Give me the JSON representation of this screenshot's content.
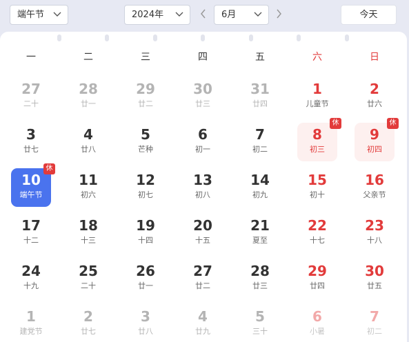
{
  "toolbar": {
    "festival_select": "端午节",
    "year_select": "2024年",
    "month_select": "6月",
    "today_label": "今天"
  },
  "weekdays": [
    "一",
    "二",
    "三",
    "四",
    "五",
    "六",
    "日"
  ],
  "colors": {
    "accent": "#4a73ee",
    "holiday_red": "#e23b3b",
    "holiday_bg": "#fdf0ef"
  },
  "weeks": [
    [
      {
        "day": "27",
        "lunar": "二十",
        "other": true
      },
      {
        "day": "28",
        "lunar": "廿一",
        "other": true
      },
      {
        "day": "29",
        "lunar": "廿二",
        "other": true
      },
      {
        "day": "30",
        "lunar": "廿三",
        "other": true
      },
      {
        "day": "31",
        "lunar": "廿四",
        "other": true
      },
      {
        "day": "1",
        "lunar": "儿童节"
      },
      {
        "day": "2",
        "lunar": "廿六"
      }
    ],
    [
      {
        "day": "3",
        "lunar": "廿七"
      },
      {
        "day": "4",
        "lunar": "廿八"
      },
      {
        "day": "5",
        "lunar": "芒种"
      },
      {
        "day": "6",
        "lunar": "初一"
      },
      {
        "day": "7",
        "lunar": "初二"
      },
      {
        "day": "8",
        "lunar": "初三",
        "holiday": true,
        "badge": "休"
      },
      {
        "day": "9",
        "lunar": "初四",
        "holiday": true,
        "badge": "休"
      }
    ],
    [
      {
        "day": "10",
        "lunar": "端午节",
        "selected": true,
        "badge": "休"
      },
      {
        "day": "11",
        "lunar": "初六"
      },
      {
        "day": "12",
        "lunar": "初七"
      },
      {
        "day": "13",
        "lunar": "初八"
      },
      {
        "day": "14",
        "lunar": "初九"
      },
      {
        "day": "15",
        "lunar": "初十"
      },
      {
        "day": "16",
        "lunar": "父亲节"
      }
    ],
    [
      {
        "day": "17",
        "lunar": "十二"
      },
      {
        "day": "18",
        "lunar": "十三"
      },
      {
        "day": "19",
        "lunar": "十四"
      },
      {
        "day": "20",
        "lunar": "十五"
      },
      {
        "day": "21",
        "lunar": "夏至"
      },
      {
        "day": "22",
        "lunar": "十七"
      },
      {
        "day": "23",
        "lunar": "十八"
      }
    ],
    [
      {
        "day": "24",
        "lunar": "十九"
      },
      {
        "day": "25",
        "lunar": "二十"
      },
      {
        "day": "26",
        "lunar": "廿一"
      },
      {
        "day": "27",
        "lunar": "廿二"
      },
      {
        "day": "28",
        "lunar": "廿三"
      },
      {
        "day": "29",
        "lunar": "廿四"
      },
      {
        "day": "30",
        "lunar": "廿五"
      }
    ],
    [
      {
        "day": "1",
        "lunar": "建党节",
        "other": true
      },
      {
        "day": "2",
        "lunar": "廿七",
        "other": true
      },
      {
        "day": "3",
        "lunar": "廿八",
        "other": true
      },
      {
        "day": "4",
        "lunar": "廿九",
        "other": true
      },
      {
        "day": "5",
        "lunar": "三十",
        "other": true
      },
      {
        "day": "6",
        "lunar": "小暑",
        "other": true
      },
      {
        "day": "7",
        "lunar": "初二",
        "other": true
      }
    ]
  ]
}
